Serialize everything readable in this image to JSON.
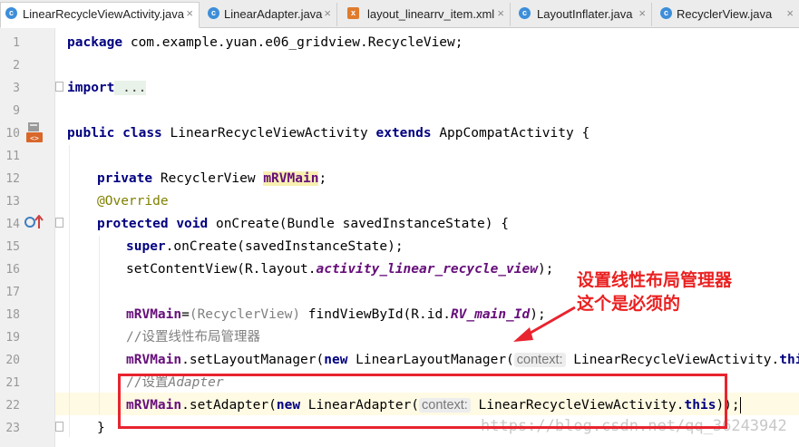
{
  "tabs": [
    {
      "label": "LinearRecycleViewActivity.java",
      "icon": "class-icon",
      "active": true
    },
    {
      "label": "LinearAdapter.java",
      "icon": "class-icon"
    },
    {
      "label": "layout_linearrv_item.xml",
      "icon": "xml-icon"
    },
    {
      "label": "LayoutInflater.java",
      "icon": "class-icon"
    },
    {
      "label": "RecyclerView.java",
      "icon": "class-icon"
    }
  ],
  "tab_close": "×",
  "line_numbers": [
    "1",
    "2",
    "3",
    "9",
    "10",
    "11",
    "12",
    "13",
    "14",
    "15",
    "16",
    "17",
    "18",
    "19",
    "20",
    "21",
    "22",
    "23"
  ],
  "code": {
    "l1_kw": "package",
    "l1_rest": " com.example.yuan.e06_gridview.RecycleView;",
    "l3_kw": "import",
    "l3_fold": " ...",
    "l10_kw1": "public",
    "l10_kw2": "class",
    "l10_name": " LinearRecycleViewActivity ",
    "l10_kw3": "extends",
    "l10_rest": " AppCompatActivity {",
    "l12_kw": "private",
    "l12_type": " RecyclerView ",
    "l12_field": "mRVMain",
    "l12_end": ";",
    "l13": "@Override",
    "l14_kw1": "protected",
    "l14_kw2": "void",
    "l14_rest": " onCreate(Bundle savedInstanceState) {",
    "l15_kw": "super",
    "l15_rest": ".onCreate(savedInstanceState);",
    "l16_a": "setContentView(R.layout.",
    "l16_b": "activity_linear_recycle_view",
    "l16_c": ");",
    "l18_field": "mRVMain",
    "l18_a": "=",
    "l18_cast": "(RecyclerView)",
    "l18_b": " findViewById(R.id.",
    "l18_id": "RV_main_Id",
    "l18_c": ");",
    "l19": "//设置线性布局管理器",
    "l20_field": "mRVMain",
    "l20_a": ".setLayoutManager(",
    "l20_kw": "new",
    "l20_b": " LinearLayoutManager(",
    "l20_hint": "context:",
    "l20_c": " LinearRecycleViewActivity.",
    "l20_this": "this",
    "l20_d": "));",
    "l21_a": "//设置",
    "l21_b": "Adapter",
    "l22_field": "mRVMain",
    "l22_a": ".setAdapter(",
    "l22_kw": "new",
    "l22_b": " LinearAdapter(",
    "l22_hint": "context:",
    "l22_c": " LinearRecycleViewActivity.",
    "l22_this": "this",
    "l22_d": "));",
    "l23": "}"
  },
  "annotation": {
    "line1": "设置线性布局管理器",
    "line2": "这个是必须的",
    "color": "#e8242f"
  },
  "watermark": "https://blog.csdn.net/qq_36243942"
}
